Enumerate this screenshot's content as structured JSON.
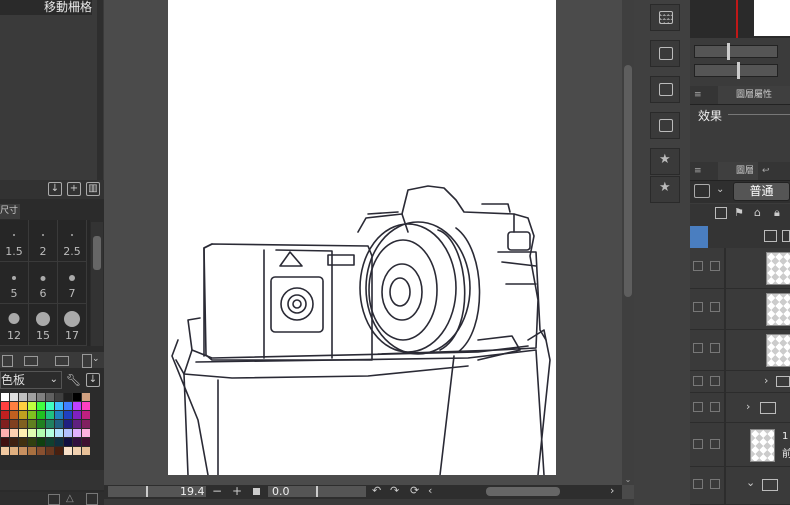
{
  "left_panel": {
    "title": "移動柵格",
    "tab_label": "尺寸",
    "brush_sizes": [
      "1.5",
      "2",
      "2.5",
      "5",
      "6",
      "7",
      "12",
      "15",
      "17"
    ],
    "color_set_label": "色板",
    "palette_colors": [
      "#ffffff",
      "#e0e0e0",
      "#c0c0c0",
      "#a0a0a0",
      "#808080",
      "#606060",
      "#404040",
      "#202020",
      "#000000",
      "#d0a080",
      "#ff4040",
      "#ff8040",
      "#ffd040",
      "#c0ff40",
      "#40ff40",
      "#40ffc0",
      "#40c0ff",
      "#4080ff",
      "#c040ff",
      "#ff40c0",
      "#c02020",
      "#c06020",
      "#c0a020",
      "#80c020",
      "#20c020",
      "#20c080",
      "#2080c0",
      "#2040c0",
      "#8020c0",
      "#c02080",
      "#802020",
      "#804020",
      "#806020",
      "#608020",
      "#208020",
      "#208060",
      "#206080",
      "#202080",
      "#602080",
      "#802060",
      "#ffb0b0",
      "#ffd0b0",
      "#fff0b0",
      "#e0ffb0",
      "#b0ffb0",
      "#b0ffe0",
      "#b0e0ff",
      "#b0c0ff",
      "#e0b0ff",
      "#ffb0e0",
      "#401010",
      "#402010",
      "#403010",
      "#304010",
      "#104010",
      "#104030",
      "#103040",
      "#101040",
      "#301040",
      "#401030",
      "#f0c8a0",
      "#e0b080",
      "#c89060",
      "#a87040",
      "#885030",
      "#683820",
      "#482010",
      "#f8e0c8",
      "#f0d0b0",
      "#e8c098"
    ]
  },
  "status": {
    "zoom": "19.4",
    "minus": "−",
    "plus": "+",
    "angle": "0.0"
  },
  "right_panel": {
    "property_tab": "圖層屬性",
    "effect_label": "效果",
    "layer_tab": "圖層",
    "blend_mode": "普通",
    "layer_text_1": "1",
    "layer_text_2": "前"
  },
  "colors": {
    "canvas_bg": "#4b4b4b",
    "panel_bg": "#3b3b3b",
    "selected_blue": "#4a7ec0"
  }
}
